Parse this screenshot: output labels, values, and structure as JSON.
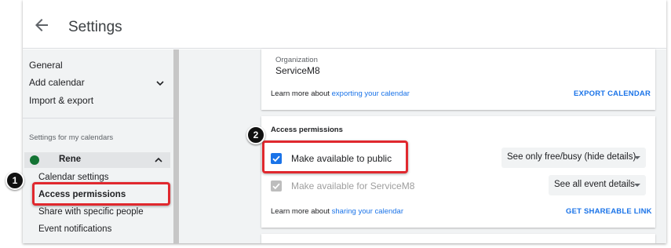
{
  "header": {
    "title": "Settings",
    "back_icon": "arrow-left-icon"
  },
  "sidebar": {
    "general": "General",
    "add_calendar": "Add calendar",
    "import_export": "Import & export",
    "section_label": "Settings for my calendars",
    "calendar": {
      "name": "Rene",
      "color": "#137333"
    },
    "sub_items": [
      "Calendar settings",
      "Access permissions",
      "Share with specific people",
      "Event notifications"
    ]
  },
  "org_card": {
    "label": "Organization",
    "value": "ServiceM8",
    "learn_prefix": "Learn more about ",
    "learn_link": "exporting your calendar",
    "action": "EXPORT CALENDAR"
  },
  "access_card": {
    "title": "Access permissions",
    "public_label": "Make available to public",
    "public_checked": true,
    "public_select": "See only free/busy (hide details)",
    "org_label": "Make available for ServiceM8",
    "org_checked": true,
    "org_select": "See all event details",
    "learn_prefix": "Learn more about ",
    "learn_link": "sharing your calendar",
    "action": "GET SHAREABLE LINK"
  },
  "callouts": {
    "one": "1",
    "two": "2"
  },
  "colors": {
    "accent": "#1a73e8",
    "callout": "#e0282e",
    "checkbox": "#1a73e8",
    "checkbox_disabled": "#bdbdbd"
  }
}
